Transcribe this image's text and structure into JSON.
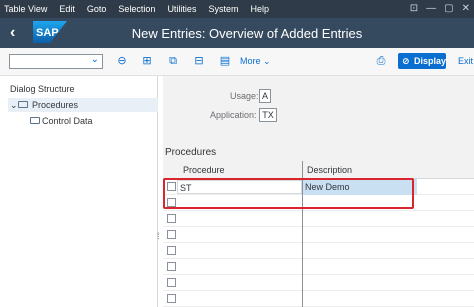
{
  "menubar": {
    "items": [
      "Table View",
      "Edit",
      "Goto",
      "Selection",
      "Utilities",
      "System",
      "Help"
    ],
    "window_controls": [
      "⊡",
      "—",
      "▢",
      "✕"
    ]
  },
  "titlebar": {
    "logo": "SAP",
    "title": "New Entries: Overview of Added Entries"
  },
  "toolbar": {
    "command_value": "",
    "more_label": "More",
    "display_label": "Display",
    "exit_label": "Exit"
  },
  "dialog_structure": {
    "header": "Dialog Structure",
    "items": [
      {
        "label": "Procedures",
        "selected": true
      },
      {
        "label": "Control Data",
        "selected": false
      }
    ]
  },
  "fields": {
    "usage_label": "Usage:",
    "usage_value": "A",
    "application_label": "Application:",
    "application_value": "TX"
  },
  "procedures": {
    "title": "Procedures",
    "columns": [
      "Procedure",
      "Description"
    ],
    "rows": [
      {
        "procedure": "ST",
        "description": "New Demo"
      },
      {
        "procedure": "",
        "description": ""
      },
      {
        "procedure": "",
        "description": ""
      },
      {
        "procedure": "",
        "description": ""
      },
      {
        "procedure": "",
        "description": ""
      },
      {
        "procedure": "",
        "description": ""
      },
      {
        "procedure": "",
        "description": ""
      },
      {
        "procedure": "",
        "description": ""
      }
    ]
  },
  "colors": {
    "menubar": "#2f3b48",
    "titlebar": "#354a5f",
    "accent": "#0a6ed1",
    "highlight": "#d9252d"
  }
}
